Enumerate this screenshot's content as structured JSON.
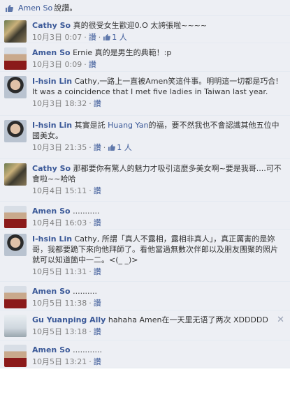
{
  "header": {
    "likers": "Amen So",
    "suffix": "說讚。"
  },
  "comments": [
    {
      "name": "Cathy So",
      "text": "真的很受女生歡迎0.O 太誇張啦~~~~",
      "date": "10月3日",
      "time": "0:07",
      "reply": "讚",
      "likes": "1 人"
    },
    {
      "name": "Amen So",
      "text": "Ernie 真的是男生的典範！:p",
      "date": "10月3日",
      "time": "0:09",
      "reply": "讚"
    },
    {
      "name": "I-hsin Lin",
      "text": "Cathy,一路上一直被Amen笑這件事。明明這一切都是巧合! It was a coincidence that I met five ladies in Taiwan last year.",
      "date": "10月3日",
      "time": "18:32",
      "reply": "讚"
    },
    {
      "name": "I-hsin Lin",
      "text_pre": "其實是託 ",
      "mention": "Huang Yan",
      "text_post": "的福，要不然我也不會認識其他五位中國美女。",
      "date": "10月3日",
      "time": "21:35",
      "reply": "讚",
      "likes": "1 人"
    },
    {
      "name": "Cathy So",
      "text": "那都要你有驚人的魅力才吸引這麼多美女啊~要是我哥....可不會啦~~哈哈",
      "date": "10月4日",
      "time": "15:11",
      "reply": "讚"
    },
    {
      "name": "Amen So",
      "text": "...........",
      "date": "10月4日",
      "time": "16:03",
      "reply": "讚"
    },
    {
      "name": "I-hsin Lin",
      "text": "Cathy, 所謂「真人不露相，露相非真人」，真正厲害的是妳哥，我都要跪下來向他拜師了。看他當過無數次伴郎以及朋友團聚的照片就可以知道箇中一二。<(_ _)>",
      "date": "10月5日",
      "time": "11:31",
      "reply": "讚"
    },
    {
      "name": "Amen So",
      "text": "..........",
      "date": "10月5日",
      "time": "11:38",
      "reply": "讚"
    },
    {
      "name": "Gu Yuanping Ally",
      "text": "hahaha Amen在一天里无语了两次 XDDDDD",
      "date": "10月5日",
      "time": "13:18",
      "reply": "讚",
      "closable": true
    },
    {
      "name": "Amen So",
      "text": "............",
      "date": "10月5日",
      "time": "13:21",
      "reply": "讚"
    }
  ],
  "colors": {
    "link": "#3b5998",
    "background": "#edeff4",
    "meta": "#808080"
  },
  "icons": {
    "like": "thumbs-up-icon",
    "close": "close-icon"
  }
}
